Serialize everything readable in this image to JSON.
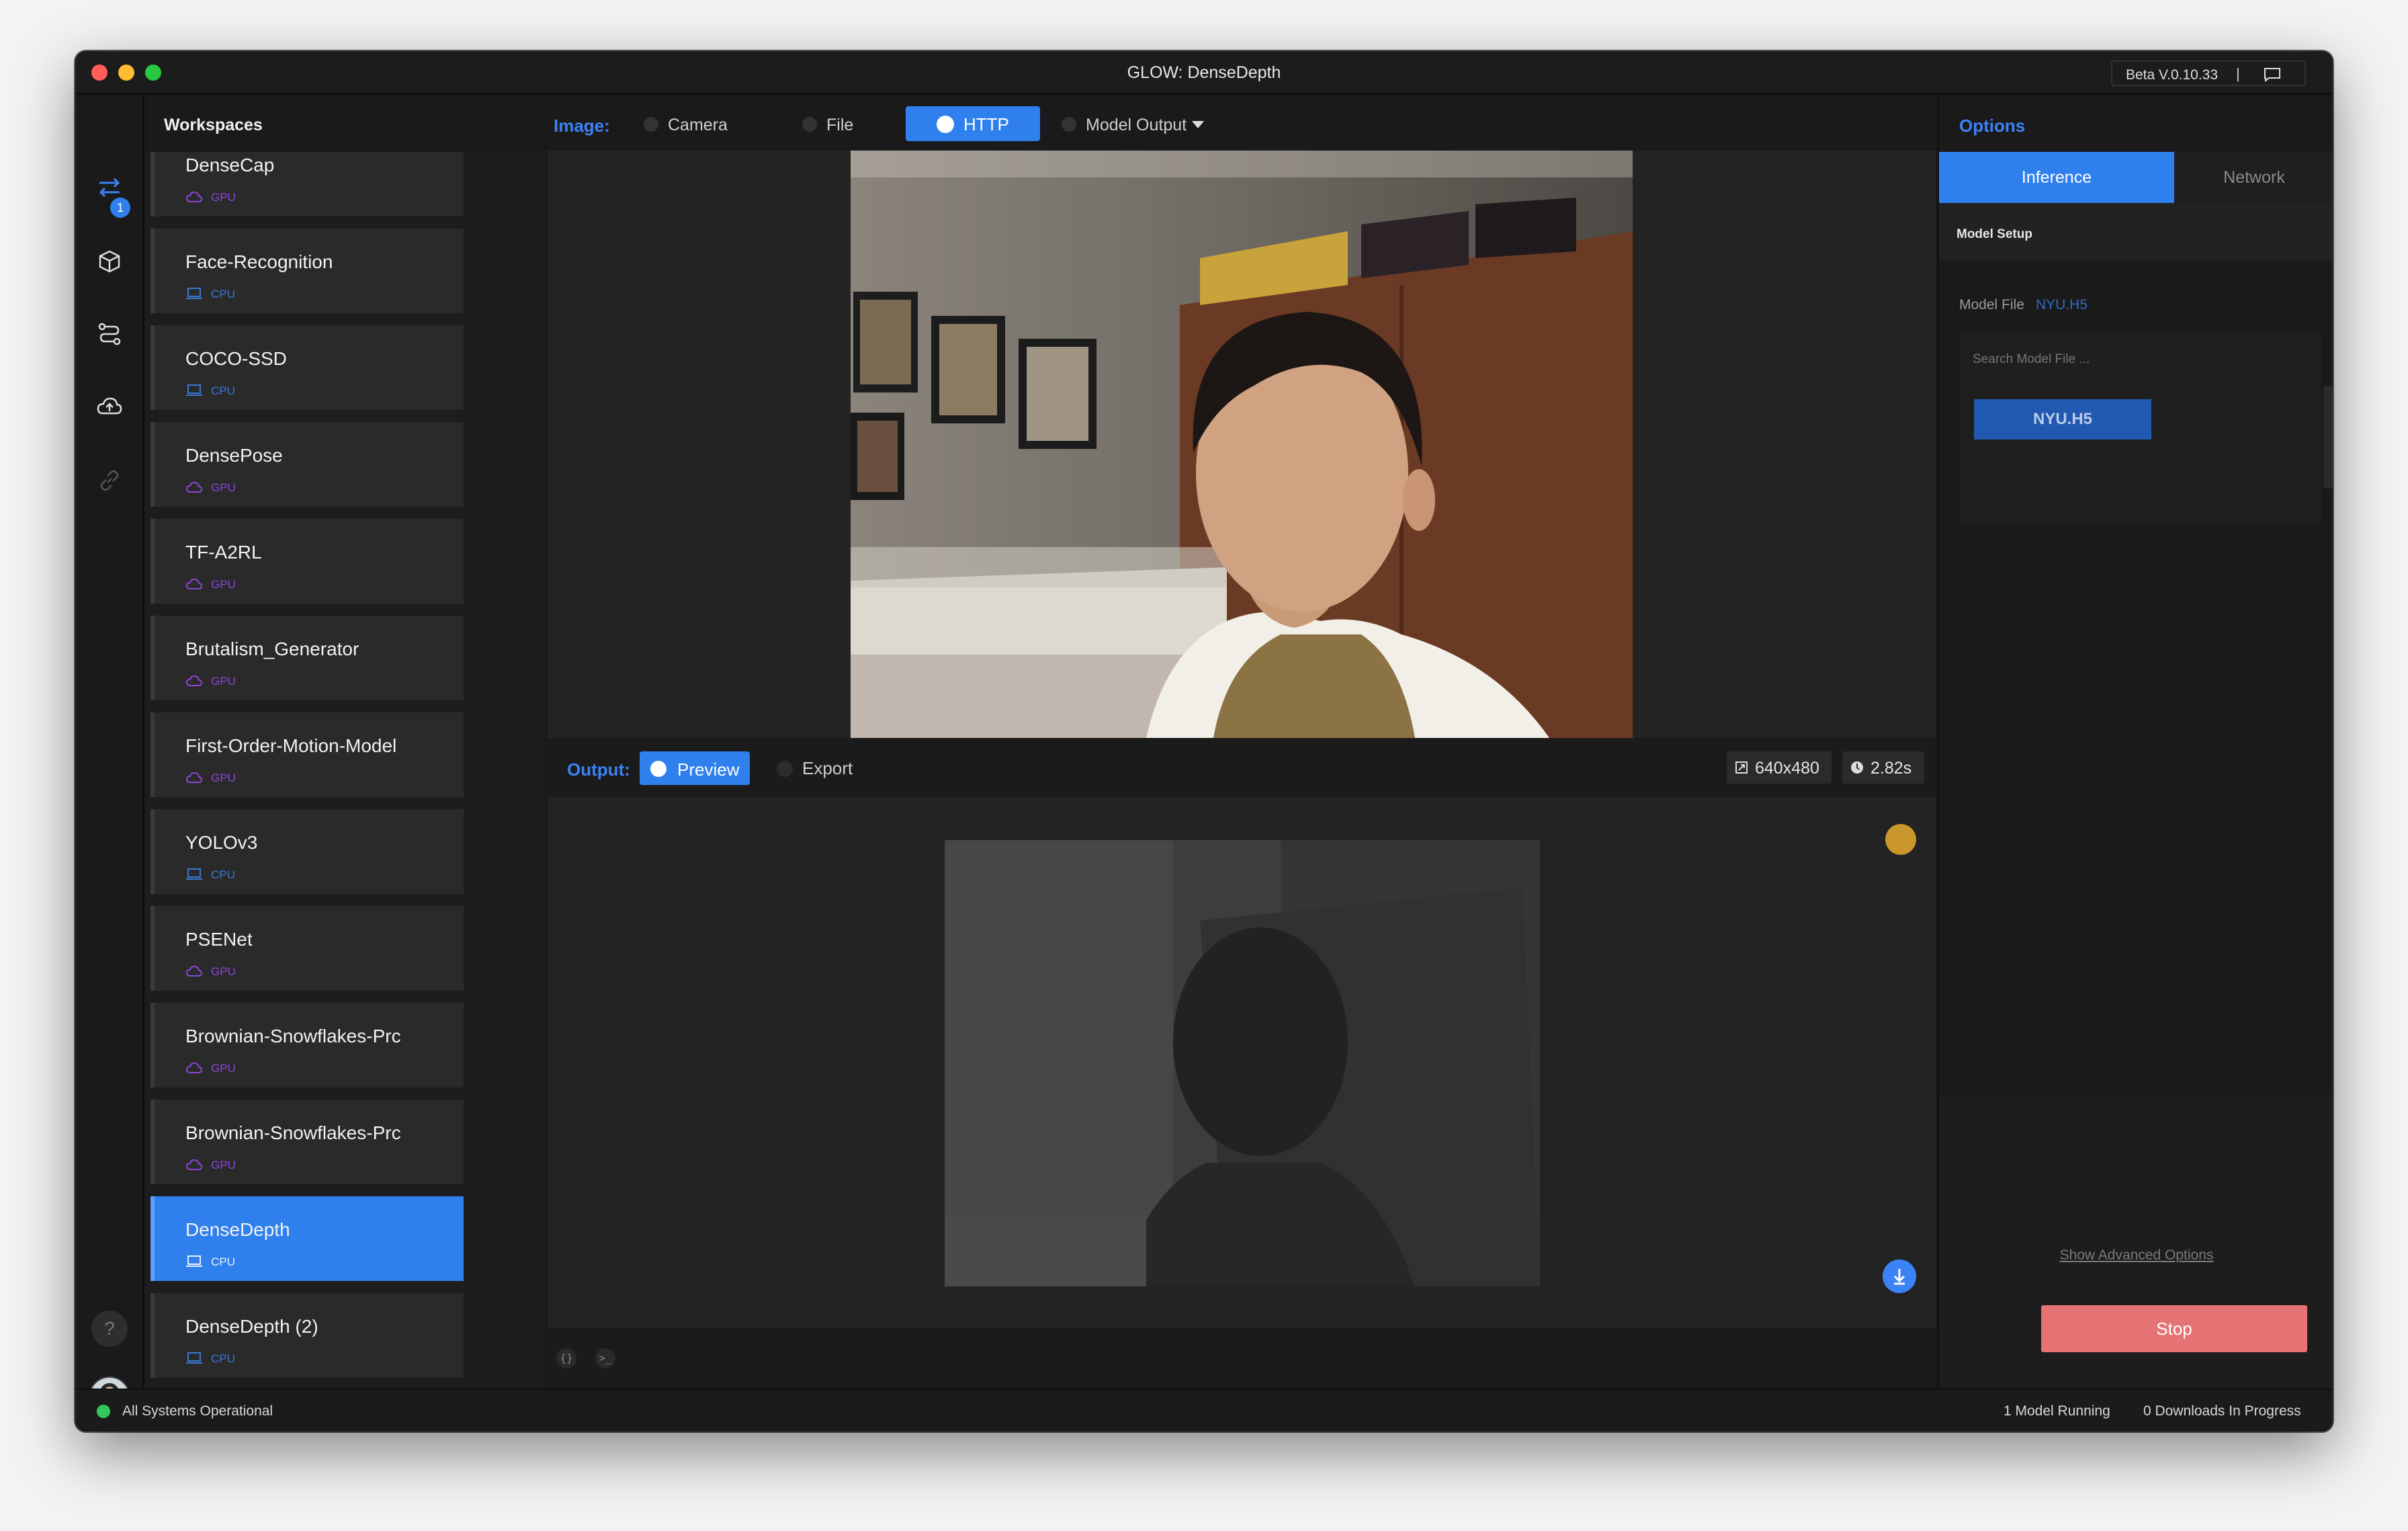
{
  "window": {
    "title": "GLOW: DenseDepth",
    "version": "Beta V.0.10.33",
    "version_separator": "|"
  },
  "rail": {
    "badge_count": "1",
    "help_label": "?"
  },
  "workspaces": {
    "title": "Workspaces",
    "items": [
      {
        "name": "DenseCap",
        "device": "GPU"
      },
      {
        "name": "Face-Recognition",
        "device": "CPU"
      },
      {
        "name": "COCO-SSD",
        "device": "CPU"
      },
      {
        "name": "DensePose",
        "device": "GPU"
      },
      {
        "name": "TF-A2RL",
        "device": "GPU"
      },
      {
        "name": "Brutalism_Generator",
        "device": "GPU"
      },
      {
        "name": "First-Order-Motion-Model",
        "device": "GPU"
      },
      {
        "name": "YOLOv3",
        "device": "CPU"
      },
      {
        "name": "PSENet",
        "device": "GPU"
      },
      {
        "name": "Brownian-Snowflakes-Prc",
        "device": "GPU"
      },
      {
        "name": "Brownian-Snowflakes-Prc",
        "device": "GPU"
      },
      {
        "name": "DenseDepth",
        "device": "CPU",
        "active": true
      },
      {
        "name": "DenseDepth (2)",
        "device": "CPU"
      }
    ]
  },
  "image_toolbar": {
    "label": "Image:",
    "sources": {
      "camera": "Camera",
      "file": "File",
      "http": "HTTP",
      "model_output": "Model Output"
    }
  },
  "output_toolbar": {
    "label": "Output:",
    "preview": "Preview",
    "export": "Export",
    "resolution": "640x480",
    "time": "2.82s"
  },
  "options": {
    "title": "Options",
    "tabs": {
      "inference": "Inference",
      "network": "Network"
    },
    "section": "Model Setup",
    "model_file_label": "Model File",
    "model_file_value": "NYU.H5",
    "search_placeholder": "Search Model File ...",
    "files": [
      "NYU.H5"
    ],
    "advanced_link": "Show Advanced Options",
    "stop_label": "Stop"
  },
  "statusbar": {
    "system": "All Systems Operational",
    "models_running": "1 Model Running",
    "downloads": "0 Downloads In Progress"
  },
  "colors": {
    "accent": "#2f80ed",
    "stop": "#e57373",
    "status_ok": "#34c759",
    "gpu": "#8b45d6",
    "cpu": "#3a78d4"
  }
}
